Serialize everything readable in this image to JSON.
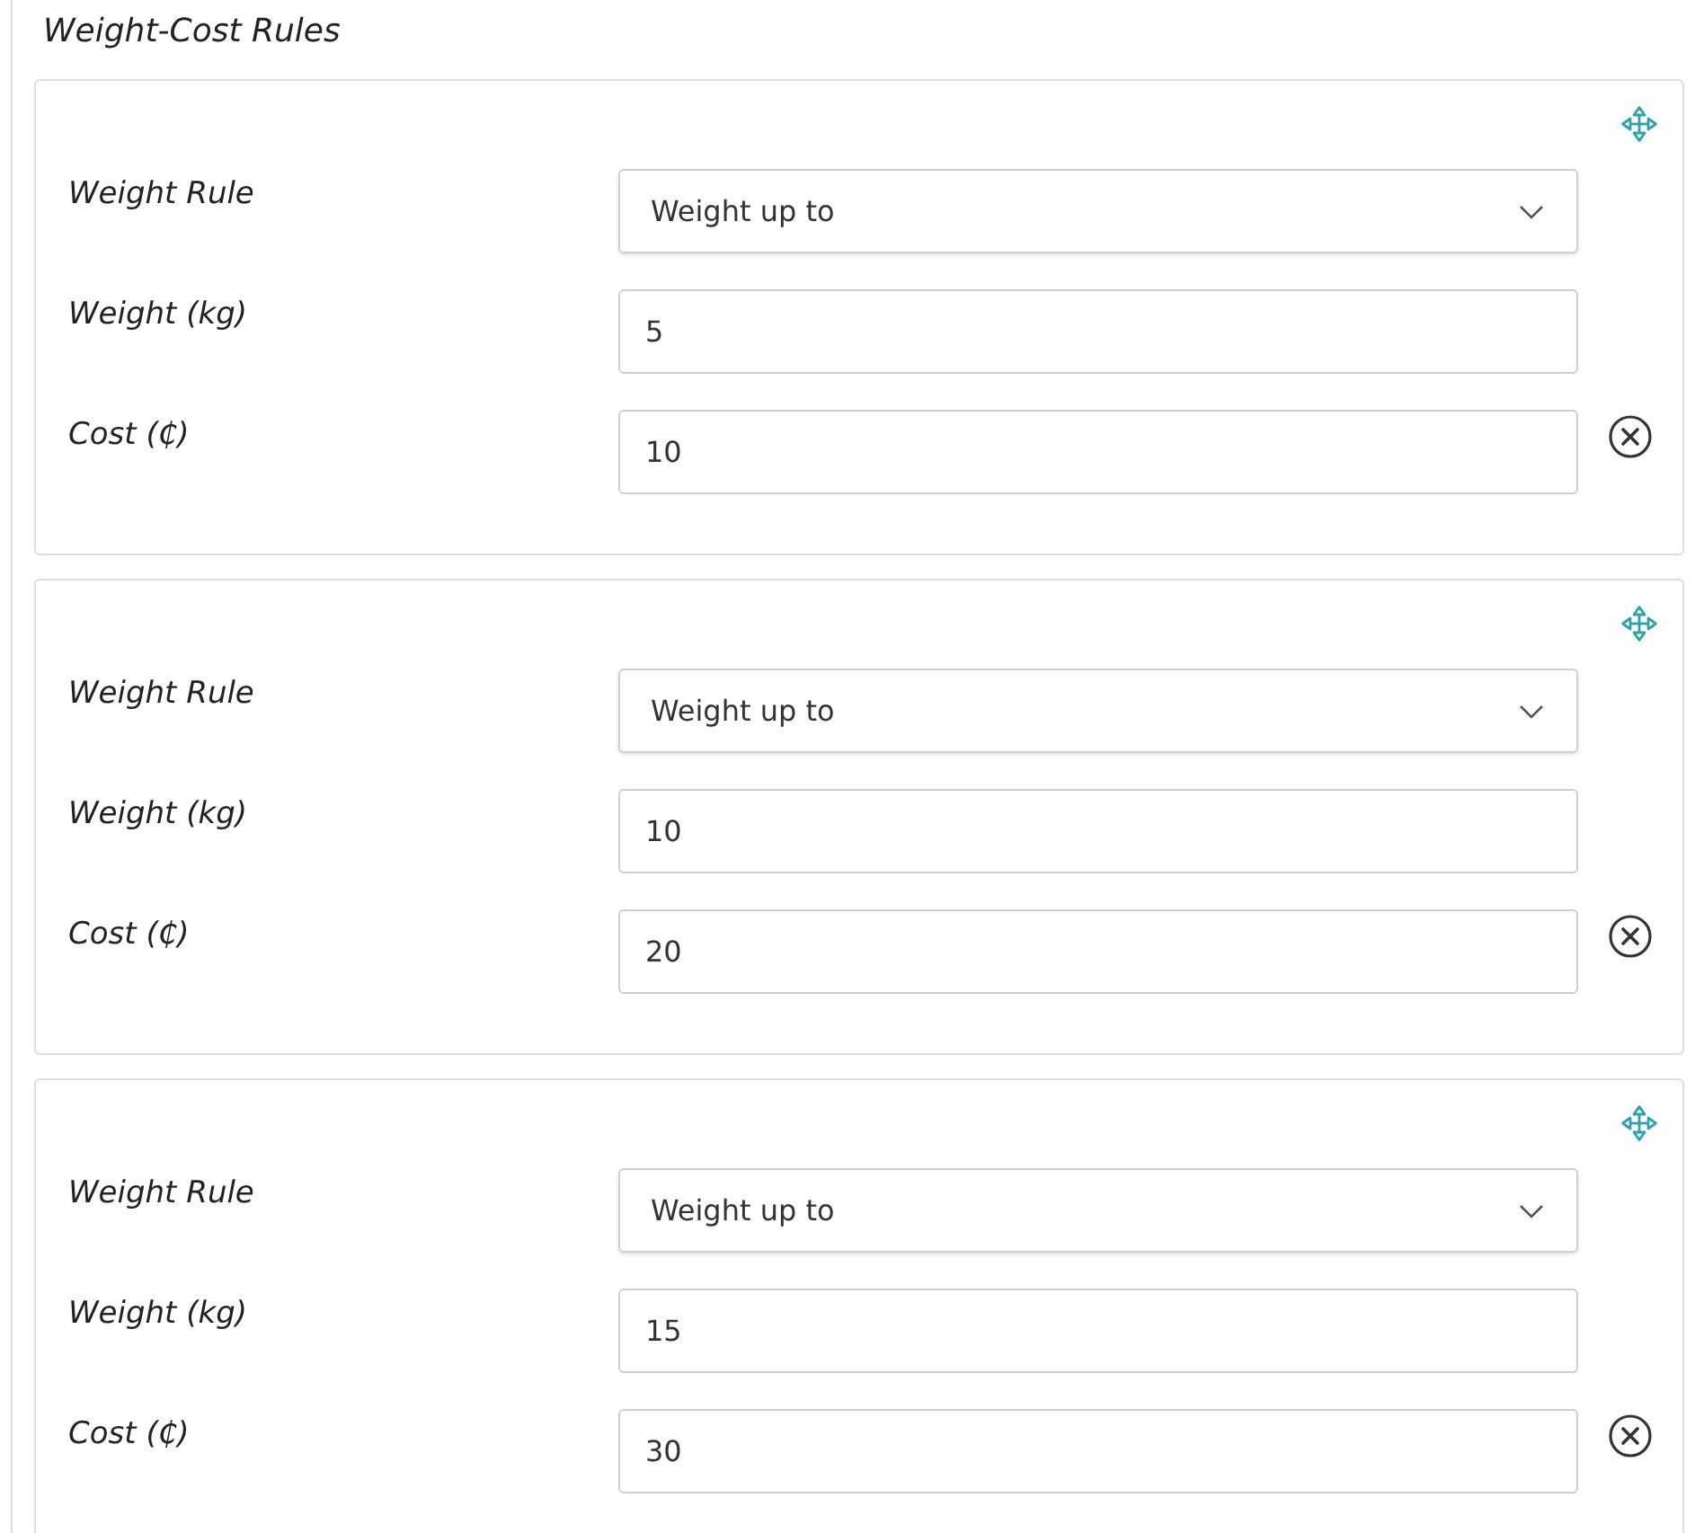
{
  "section": {
    "title": "Weight-Cost Rules"
  },
  "rules": [
    {
      "fields": [
        {
          "kind": "select",
          "label": "Weight Rule",
          "value": "Weight up to"
        },
        {
          "kind": "input",
          "label": "Weight (kg)",
          "value": "5"
        },
        {
          "kind": "input",
          "label": "Cost (₵)",
          "value": "10"
        }
      ]
    },
    {
      "fields": [
        {
          "kind": "select",
          "label": "Weight Rule",
          "value": "Weight up to"
        },
        {
          "kind": "input",
          "label": "Weight (kg)",
          "value": "10"
        },
        {
          "kind": "input",
          "label": "Cost (₵)",
          "value": "20"
        }
      ]
    },
    {
      "fields": [
        {
          "kind": "select",
          "label": "Weight Rule",
          "value": "Weight up to"
        },
        {
          "kind": "input",
          "label": "Weight (kg)",
          "value": "15"
        },
        {
          "kind": "input",
          "label": "Cost (₵)",
          "value": "30"
        }
      ]
    }
  ]
}
